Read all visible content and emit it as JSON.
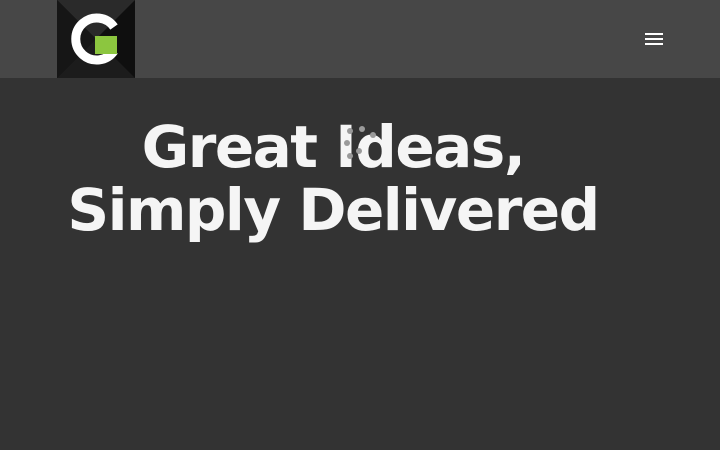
{
  "header": {
    "logo": {
      "letter": "G",
      "colors": {
        "background": "#111111",
        "accent": "#8cc63f",
        "letter": "#ffffff"
      }
    },
    "menu_icon": "hamburger-menu-icon"
  },
  "hero": {
    "headline_line1": "Great Ideas,",
    "headline_line2": "Simply Delivered"
  },
  "colors": {
    "header_bg": "#474747",
    "page_bg": "#333333",
    "headline_text": "#f5f5f5"
  }
}
